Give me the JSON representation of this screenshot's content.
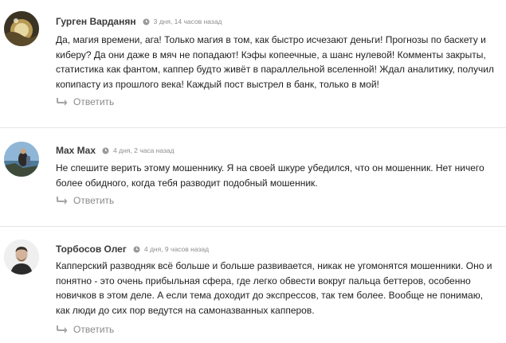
{
  "comments": [
    {
      "author": "Гурген Варданян",
      "date": "3 дня, 14 часов назад",
      "text": "Да, магия времени, ага! Только магия в том, как быстро исчезают деньги! Прогнозы по баскету и киберу? Да они даже в мяч не попадают! Кэфы копеечные, а шанс нулевой! Комменты закрыты, статистика как фантом, каппер будто живёт в параллельной вселенной! Ждал аналитику, получил копипасту из прошлого века! Каждый пост выстрел в банк, только в мой!",
      "reply_label": "Ответить",
      "avatar_icon": "avatar-photo-landscape"
    },
    {
      "author": "Max Max",
      "date": "4 дня, 2 часа назад",
      "text": "Не спешите верить этому мошеннику. Я на своей шкуре убедился, что он мошенник. Нет ничего более обидного, когда тебя разводит подобный мошенник.",
      "reply_label": "Ответить",
      "avatar_icon": "avatar-photo-seaside"
    },
    {
      "author": "Торбосов Олег",
      "date": "4 дня, 9 часов назад",
      "text": "Капперский разводняк всё больше и больше развивается, никак не угомонятся мошенники. Оно и понятно - это очень прибыльная сфера, где легко обвести вокруг пальца беттеров, особенно новичков в этом деле. А если тема доходит до экспрессов, так тем более. Вообще не понимаю, как люди до сих пор ведутся на самоназванных капперов.",
      "reply_label": "Ответить",
      "avatar_icon": "avatar-photo-portrait"
    }
  ],
  "colors": {
    "author": "#3a3a3a",
    "meta": "#8e8e8e",
    "reply": "#8a8a8a",
    "divider": "#e6e6e6"
  }
}
